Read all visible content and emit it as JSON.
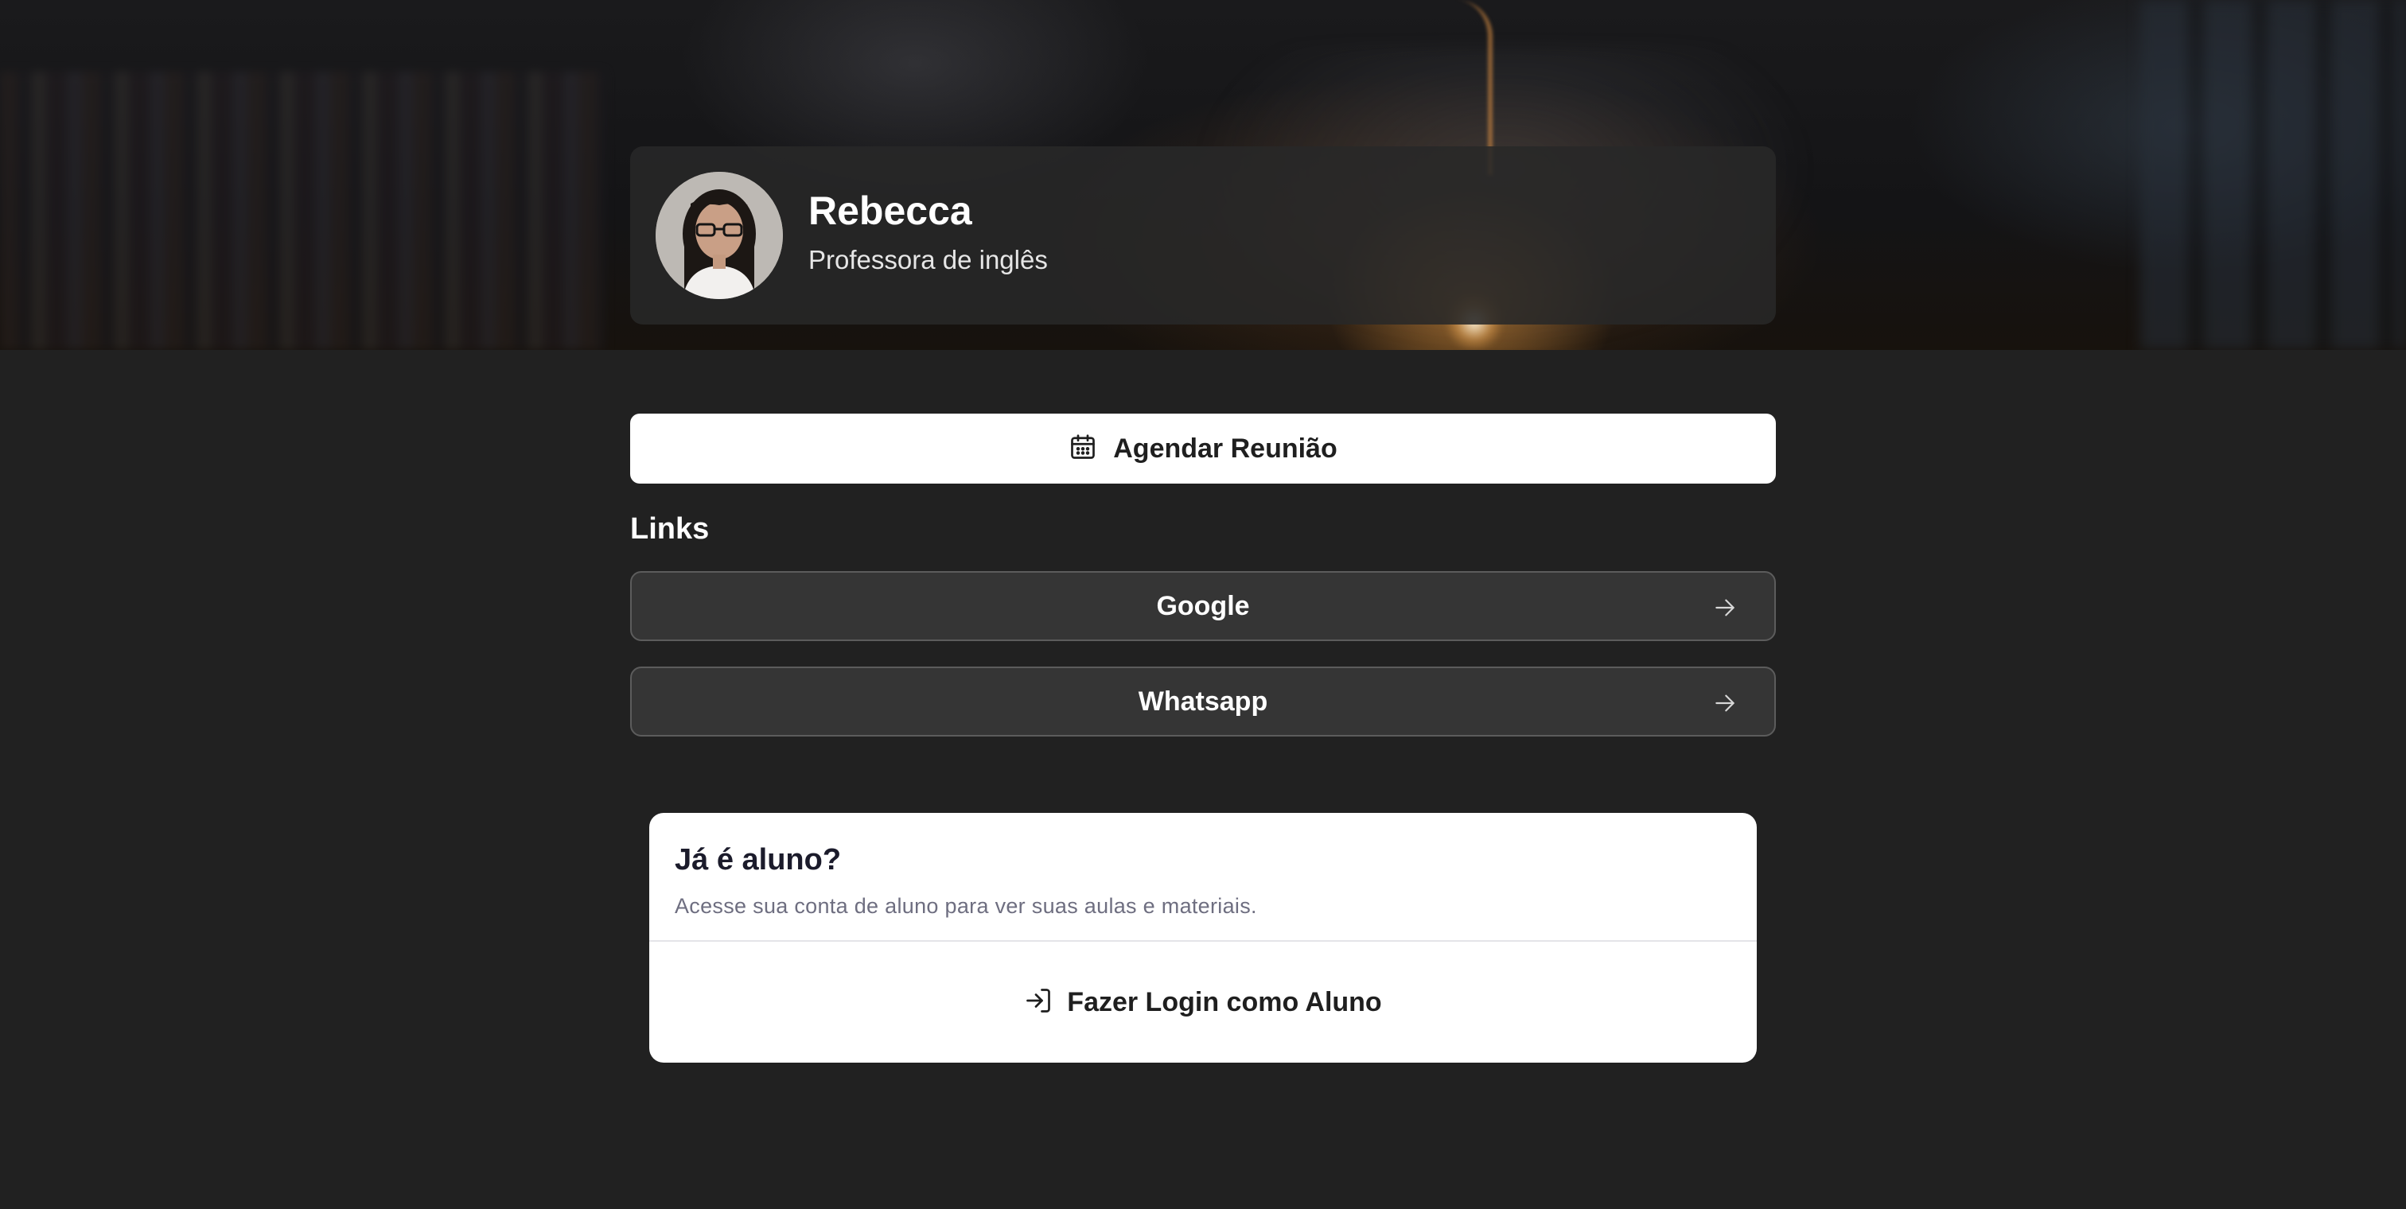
{
  "profile": {
    "name": "Rebecca",
    "subtitle": "Professora de inglês"
  },
  "actions": {
    "schedule_label": "Agendar Reunião",
    "schedule_icon": "calendar-icon"
  },
  "links": {
    "heading": "Links",
    "items": [
      {
        "label": "Google",
        "icon": "arrow-right-icon"
      },
      {
        "label": "Whatsapp",
        "icon": "arrow-right-icon"
      }
    ]
  },
  "student_card": {
    "title": "Já é aluno?",
    "description": "Acesse sua conta de aluno para ver suas aulas e materiais.",
    "login_label": "Fazer Login como Aluno",
    "login_icon": "log-in-icon"
  },
  "colors": {
    "background": "#212121",
    "card": "#282828",
    "link_button": "#353535",
    "primary_button": "#ffffff"
  }
}
